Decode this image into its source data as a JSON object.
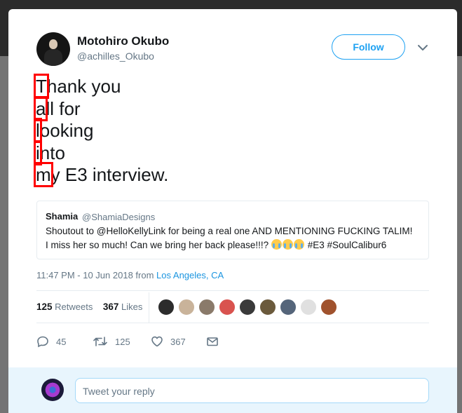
{
  "author": {
    "name": "Motohiro Okubo",
    "handle": "@achilles_Okubo"
  },
  "follow_label": "Follow",
  "tweet_lines": [
    {
      "hl": "T",
      "rest": "hank you"
    },
    {
      "hl": "a",
      "rest": "ll for"
    },
    {
      "hl": "l",
      "rest": "ooking"
    },
    {
      "hl": "i",
      "rest": "nto"
    },
    {
      "hl": "m",
      "rest": "y E3 interview."
    }
  ],
  "quote": {
    "name": "Shamia",
    "handle": "@ShamiaDesigns",
    "text_line1": "Shoutout to @HelloKellyLink for being a real one AND MENTIONING FUCKING TALIM!",
    "text_line2_prefix": "I miss her so much! Can we bring her back please!!!?",
    "text_line2_suffix": "#E3 #SoulCalibur6",
    "emoji": "loudly-crying-face"
  },
  "meta": {
    "time": "11:47 PM - 10 Jun 2018 from",
    "location": "Los Angeles, CA"
  },
  "stats": {
    "retweets_count": "125",
    "retweets_label": "Retweets",
    "likes_count": "367",
    "likes_label": "Likes"
  },
  "liker_colors": [
    "#2c2c2c",
    "#c9b39a",
    "#8a7a6a",
    "#d9534f",
    "#3a3a3a",
    "#6b5a3c",
    "#55657a",
    "#e0e0e0",
    "#a0522d",
    "#c8a36a"
  ],
  "actions": {
    "reply_count": "45",
    "retweet_count": "125",
    "like_count": "367"
  },
  "reply": {
    "placeholder": "Tweet your reply"
  },
  "colors": {
    "accent": "#1da1f2",
    "highlight": "#ff0000"
  }
}
